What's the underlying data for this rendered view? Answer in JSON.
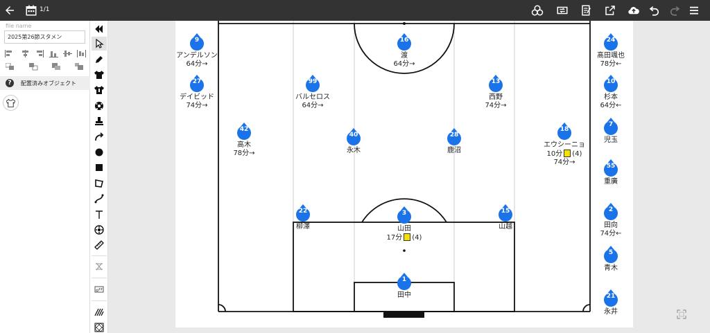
{
  "app": {
    "page_count": "1/1",
    "icons": {
      "back": "arrow-left-icon",
      "pages": "calendar-grid-icon",
      "share": "share-circles-icon",
      "transfer": "transfer-icon",
      "edit": "edit-notes-icon",
      "export": "export-icon",
      "cloud": "cloud-upload-icon",
      "undo": "undo-icon",
      "redo": "redo-icon",
      "menu": "hamburger-menu-icon"
    }
  },
  "file": {
    "label": "file name",
    "value": "2025第26節スタメン"
  },
  "panel": {
    "placed_objects_label": "配置済みオブジェクト"
  },
  "toolbar": {
    "tools": [
      "collapse",
      "select",
      "pen",
      "shirt-black",
      "shirt-dark",
      "ball",
      "stamp",
      "curve-arrow",
      "circle",
      "square",
      "polygon",
      "curve",
      "text",
      "ball-alt",
      "ruler",
      "grid",
      "off-toggle",
      "pattern-a",
      "pattern-b"
    ]
  },
  "colors": {
    "topbar": "#333333",
    "marker": "#1a73e8",
    "yellow_card": "#f5e000"
  },
  "starters": [
    {
      "num": "16",
      "name": "渡",
      "sub": "64分→"
    },
    {
      "num": "99",
      "name": "バルセロス",
      "sub": "64分→"
    },
    {
      "num": "13",
      "name": "西野",
      "sub": "74分→"
    },
    {
      "num": "42",
      "name": "高木",
      "sub": "78分→"
    },
    {
      "num": "40",
      "name": "永木",
      "sub": ""
    },
    {
      "num": "28",
      "name": "鹿沼",
      "sub": ""
    },
    {
      "num": "18",
      "name": "エウシーニョ",
      "card_time": "10分",
      "card_note": "(4)",
      "sub": "74分→"
    },
    {
      "num": "22",
      "name": "柳澤",
      "sub": ""
    },
    {
      "num": "3",
      "name": "山田",
      "card_time": "17分",
      "card_note": "(4)",
      "sub": ""
    },
    {
      "num": "15",
      "name": "山越",
      "sub": ""
    },
    {
      "num": "1",
      "name": "田中",
      "sub": ""
    }
  ],
  "left_bench": [
    {
      "num": "9",
      "name": "アンデルソン",
      "sub": "64分→"
    },
    {
      "num": "27",
      "name": "デイビッド",
      "sub": "74分→"
    }
  ],
  "right_bench": [
    {
      "num": "24",
      "name": "髙田颯也",
      "sub": "78分←"
    },
    {
      "num": "10",
      "name": "杉本",
      "sub": "64分←"
    },
    {
      "num": "7",
      "name": "児玉",
      "sub": ""
    },
    {
      "num": "55",
      "name": "重廣",
      "sub": ""
    },
    {
      "num": "2",
      "name": "田向",
      "sub": "74分←"
    },
    {
      "num": "5",
      "name": "青木",
      "sub": ""
    },
    {
      "num": "21",
      "name": "永井",
      "sub": ""
    }
  ]
}
